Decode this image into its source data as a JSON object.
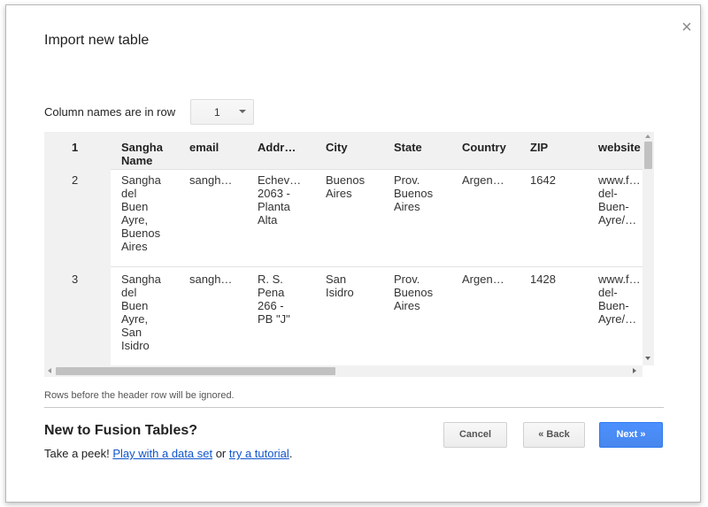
{
  "dialog": {
    "title": "Import new table",
    "close_glyph": "×",
    "column_names_label": "Column names are in row",
    "column_row_select": {
      "value": "1"
    },
    "note": "Rows before the header row will be ignored.",
    "new_title": "New to Fusion Tables?",
    "peek_prefix": "Take a peek!",
    "peek_link1": "Play with a data set",
    "peek_mid": "or",
    "peek_link2": "try a tutorial",
    "peek_suffix": ".",
    "buttons": {
      "cancel": "Cancel",
      "back": "« Back",
      "next": "Next »"
    }
  },
  "table": {
    "header_row_number": "1",
    "headers": [
      "Sangha\nName",
      "email",
      "Addr…",
      "City",
      "State",
      "Country",
      "ZIP",
      "website"
    ],
    "rows": [
      {
        "row_number": "2",
        "cells": [
          "Sangha\ndel\nBuen\nAyre,\nBuenos\nAires",
          "sangh…",
          "Echev…\n2063 -\nPlanta\nAlta",
          "Buenos\nAires",
          "Prov.\nBuenos\nAires",
          "Argen…",
          "1642",
          "www.f…\ndel-\nBuen-\nAyre/…"
        ]
      },
      {
        "row_number": "3",
        "cells": [
          "Sangha\ndel\nBuen\nAyre,\nSan\nIsidro",
          "sangh…",
          "R. S.\nPena\n266 -\nPB \"J\"",
          "San\nIsidro",
          "Prov.\nBuenos\nAires",
          "Argen…",
          "1428",
          "www.f…\ndel-\nBuen-\nAyre/…"
        ]
      }
    ]
  },
  "colors": {
    "accent": "#4d90fe",
    "link": "#1155cc"
  },
  "icons": {
    "close": "close-icon",
    "select_arrow": "chevron-down-icon"
  }
}
